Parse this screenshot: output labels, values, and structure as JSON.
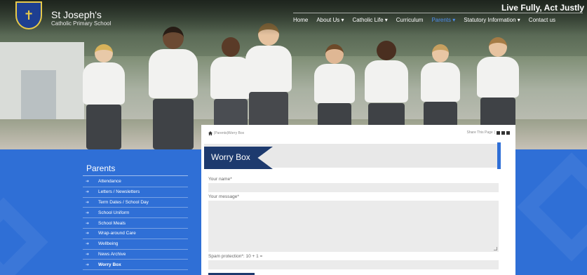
{
  "header": {
    "school_name": "St Joseph's",
    "school_subtitle": "Catholic Primary School",
    "motto": "Live Fully, Act Justly"
  },
  "nav": [
    {
      "label": "Home",
      "active": false
    },
    {
      "label": "About Us",
      "caret": "▾",
      "active": false
    },
    {
      "label": "Catholic Life",
      "caret": "▾",
      "active": false
    },
    {
      "label": "Curriculum",
      "active": false
    },
    {
      "label": "Parents",
      "caret": "▾",
      "active": true
    },
    {
      "label": "Statutory Information",
      "caret": "▾",
      "active": false
    },
    {
      "label": "Contact us",
      "active": false
    }
  ],
  "sidebar": {
    "title": "Parents",
    "items": [
      {
        "label": "Attendance"
      },
      {
        "label": "Letters / Newsletters"
      },
      {
        "label": "Term Dates / School Day"
      },
      {
        "label": "School Uniform"
      },
      {
        "label": "School Meals"
      },
      {
        "label": "Wrap-around Care"
      },
      {
        "label": "Wellbeing"
      },
      {
        "label": "News Archive"
      },
      {
        "label": "Worry Box",
        "current": true
      }
    ]
  },
  "breadcrumb": {
    "parent": "Parents",
    "separator": "|",
    "current": "Worry Box"
  },
  "share": {
    "label": "Share This Page"
  },
  "page": {
    "title": "Worry Box"
  },
  "form": {
    "name_label": "Your name*",
    "message_label": "Your message*",
    "spam_label": "Spam protection*: 10 + 1 ="
  },
  "colors": {
    "brand_blue": "#2f6fd6",
    "navy": "#1d3a6e",
    "nav_active": "#4e8ff0"
  },
  "icons": {
    "home": "home-icon",
    "sidebar_arrow": "arrow-right-icon"
  }
}
